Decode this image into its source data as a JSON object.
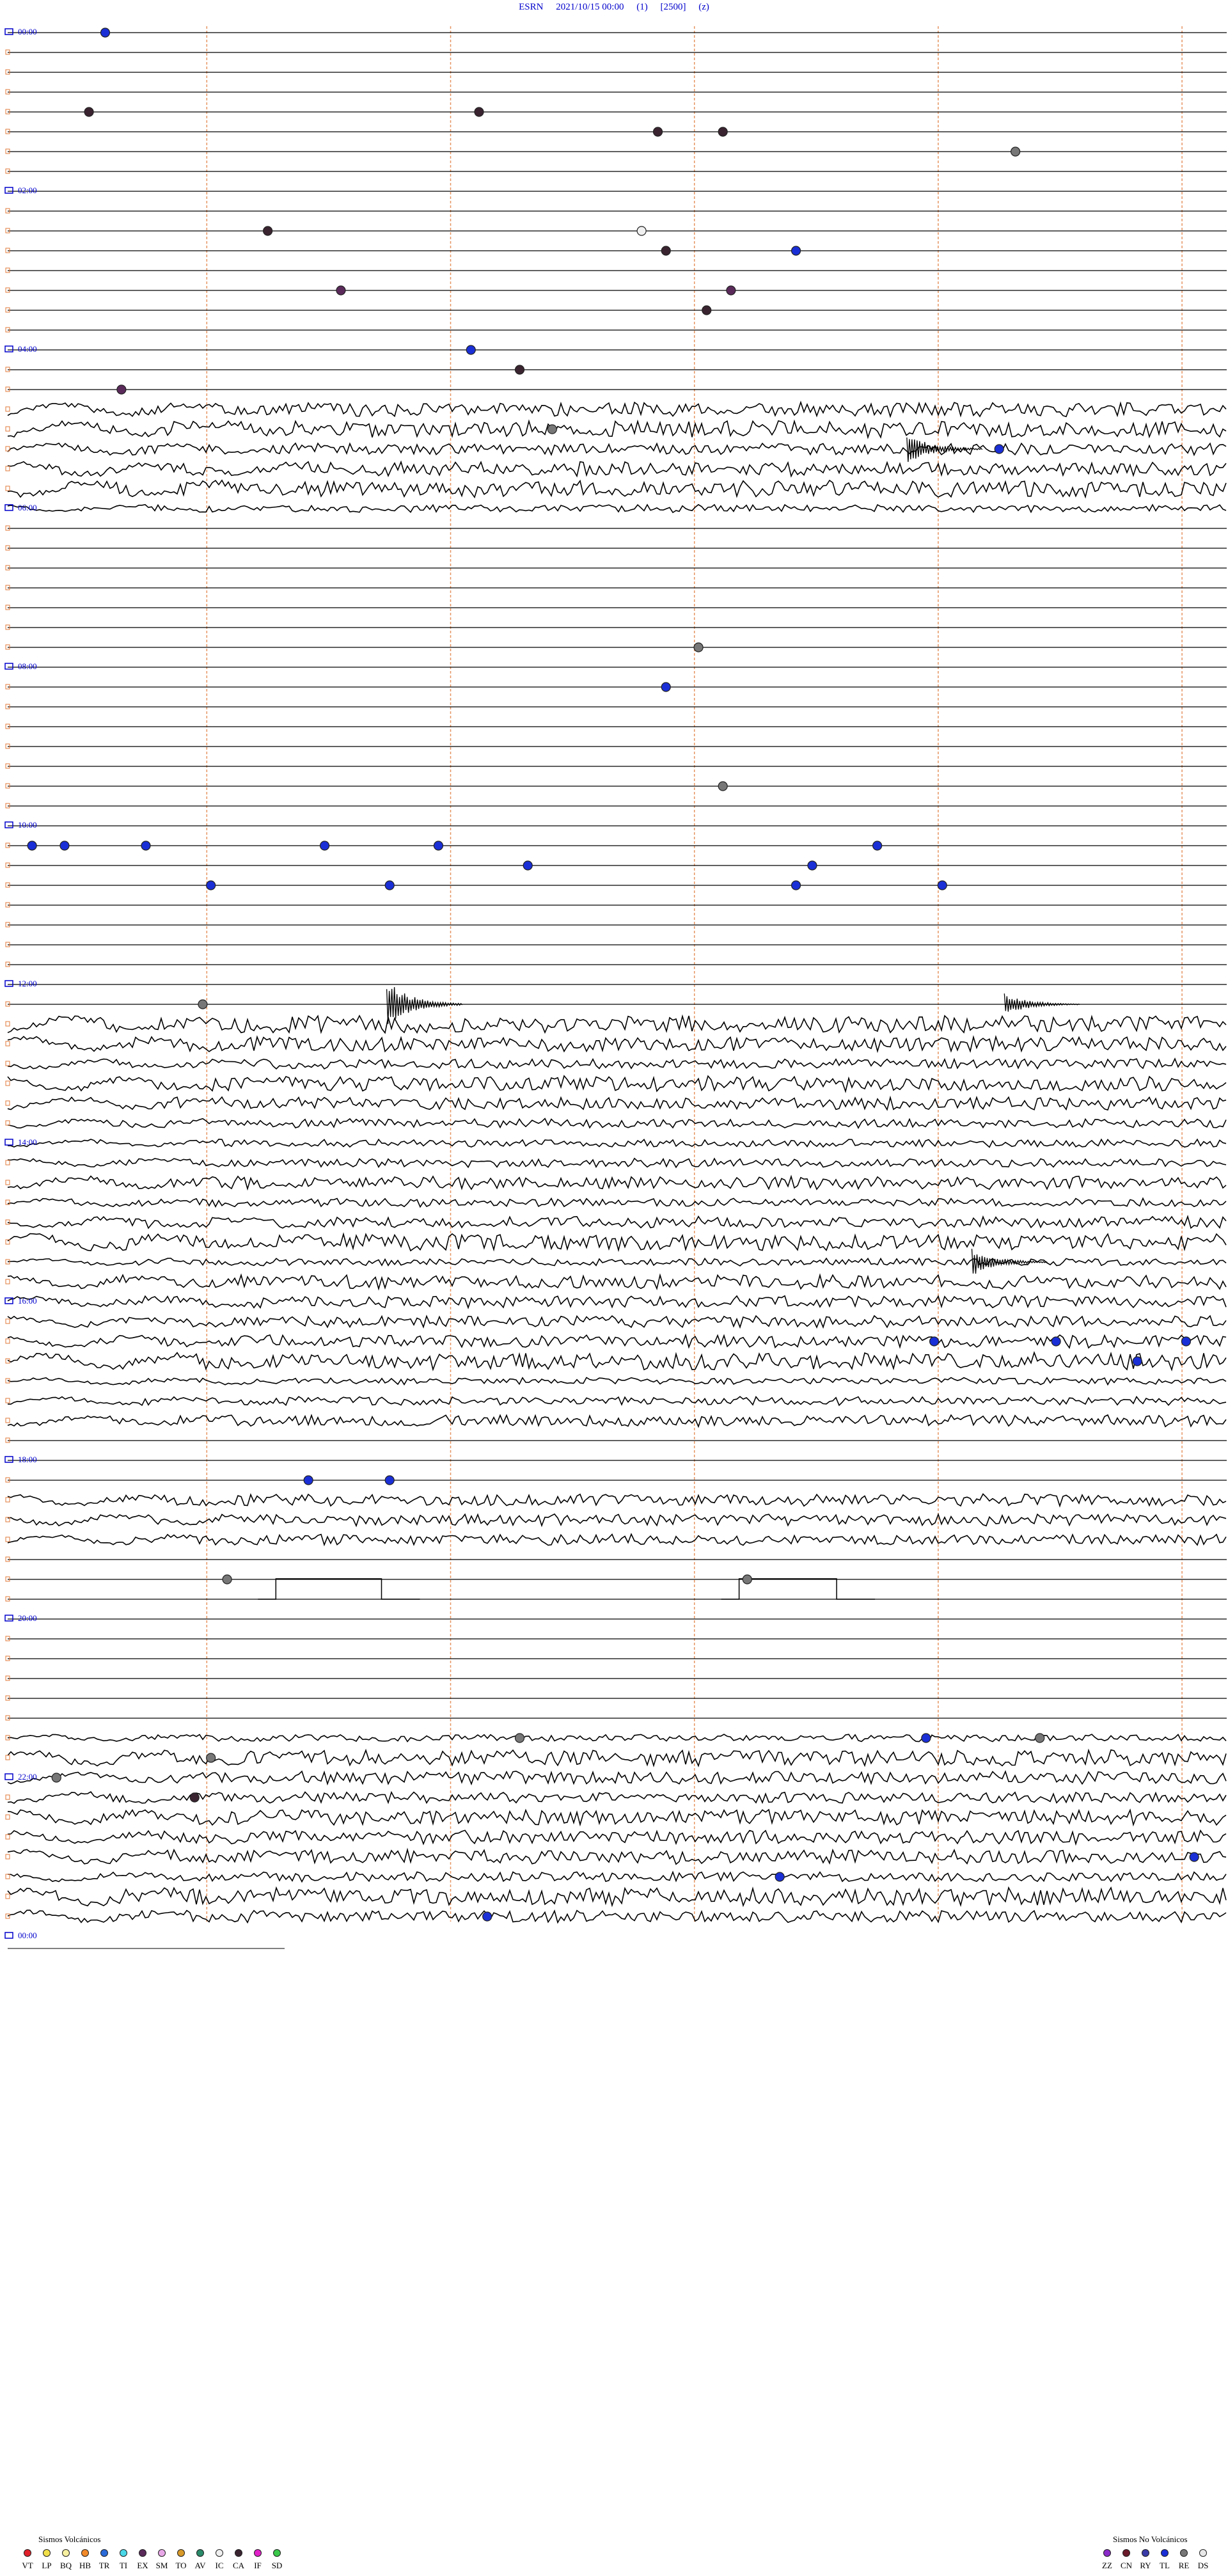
{
  "header": {
    "station": "ESRN",
    "datetime": "2021/10/15 00:00",
    "channel": "(1)",
    "scale": "[2500]",
    "mode": "(z)"
  },
  "chart_data": {
    "type": "helicorder",
    "rows": 96,
    "minutes_per_row": 15,
    "hour_labels": [
      "00:00",
      "02:00",
      "04:00",
      "06:00",
      "08:00",
      "10:00",
      "12:00",
      "14:00",
      "16:00",
      "18:00",
      "20:00",
      "22:00",
      "00:00"
    ],
    "minute_marker_count": 5,
    "colors": {
      "hour_label": "#0000cc",
      "trace": "#000000",
      "minute_marker": "#e07a3a",
      "event_blue": "#1a2fd6",
      "event_grey": "#777777",
      "event_dark": "#3a2430"
    },
    "noisy_row_ranges": [
      [
        19,
        24
      ],
      [
        50,
        70
      ],
      [
        74,
        76
      ],
      [
        86,
        95
      ]
    ],
    "spikes": [
      {
        "row": 21,
        "minute": 11.3,
        "amp": 1.0
      },
      {
        "row": 49,
        "minute": 4.9,
        "amp": 1.6
      },
      {
        "row": 49,
        "minute": 12.5,
        "amp": 0.7
      },
      {
        "row": 62,
        "minute": 12.1,
        "amp": 0.9
      }
    ],
    "step_pulses": [
      {
        "row": 79,
        "start_minute": 3.3,
        "end_minute": 4.6,
        "amp": 1.6
      },
      {
        "row": 79,
        "start_minute": 9.0,
        "end_minute": 10.2,
        "amp": 1.6
      }
    ],
    "events": [
      {
        "row": 0,
        "minute": 1.2,
        "type": "TL"
      },
      {
        "row": 4,
        "minute": 1.0,
        "type": "CA"
      },
      {
        "row": 4,
        "minute": 5.8,
        "type": "CA"
      },
      {
        "row": 5,
        "minute": 8.0,
        "type": "CA"
      },
      {
        "row": 5,
        "minute": 8.8,
        "type": "CA"
      },
      {
        "row": 6,
        "minute": 12.4,
        "type": "RE"
      },
      {
        "row": 10,
        "minute": 3.2,
        "type": "CA"
      },
      {
        "row": 10,
        "minute": 7.8,
        "type": "IC"
      },
      {
        "row": 11,
        "minute": 9.7,
        "type": "TL"
      },
      {
        "row": 11,
        "minute": 8.1,
        "type": "CA"
      },
      {
        "row": 13,
        "minute": 4.1,
        "type": "EX"
      },
      {
        "row": 13,
        "minute": 8.9,
        "type": "EX"
      },
      {
        "row": 14,
        "minute": 8.6,
        "type": "CA"
      },
      {
        "row": 16,
        "minute": 5.7,
        "type": "TL"
      },
      {
        "row": 17,
        "minute": 6.3,
        "type": "CA"
      },
      {
        "row": 18,
        "minute": 1.4,
        "type": "EX"
      },
      {
        "row": 20,
        "minute": 6.7,
        "type": "RE"
      },
      {
        "row": 21,
        "minute": 12.2,
        "type": "TL"
      },
      {
        "row": 31,
        "minute": 8.5,
        "type": "RE"
      },
      {
        "row": 33,
        "minute": 8.1,
        "type": "TL"
      },
      {
        "row": 38,
        "minute": 8.8,
        "type": "RE"
      },
      {
        "row": 41,
        "minute": 0.3,
        "type": "TL"
      },
      {
        "row": 41,
        "minute": 0.7,
        "type": "TL"
      },
      {
        "row": 41,
        "minute": 1.7,
        "type": "TL"
      },
      {
        "row": 41,
        "minute": 3.9,
        "type": "TL"
      },
      {
        "row": 41,
        "minute": 5.3,
        "type": "TL"
      },
      {
        "row": 41,
        "minute": 10.7,
        "type": "TL"
      },
      {
        "row": 42,
        "minute": 6.4,
        "type": "TL"
      },
      {
        "row": 42,
        "minute": 9.9,
        "type": "TL"
      },
      {
        "row": 43,
        "minute": 2.5,
        "type": "TL"
      },
      {
        "row": 43,
        "minute": 9.7,
        "type": "TL"
      },
      {
        "row": 43,
        "minute": 11.5,
        "type": "TL"
      },
      {
        "row": 43,
        "minute": 4.7,
        "type": "TL"
      },
      {
        "row": 49,
        "minute": 2.4,
        "type": "RE"
      },
      {
        "row": 66,
        "minute": 11.4,
        "type": "TL"
      },
      {
        "row": 66,
        "minute": 12.9,
        "type": "TL"
      },
      {
        "row": 66,
        "minute": 14.5,
        "type": "TL"
      },
      {
        "row": 67,
        "minute": 13.9,
        "type": "TL"
      },
      {
        "row": 73,
        "minute": 3.7,
        "type": "TL"
      },
      {
        "row": 73,
        "minute": 4.7,
        "type": "TL"
      },
      {
        "row": 78,
        "minute": 2.7,
        "type": "RE"
      },
      {
        "row": 78,
        "minute": 9.1,
        "type": "RE"
      },
      {
        "row": 86,
        "minute": 6.3,
        "type": "RE"
      },
      {
        "row": 86,
        "minute": 11.3,
        "type": "TL"
      },
      {
        "row": 86,
        "minute": 12.7,
        "type": "RE"
      },
      {
        "row": 87,
        "minute": 2.5,
        "type": "RE"
      },
      {
        "row": 88,
        "minute": 0.6,
        "type": "RE"
      },
      {
        "row": 89,
        "minute": 2.3,
        "type": "CA"
      },
      {
        "row": 92,
        "minute": 14.6,
        "type": "TL"
      },
      {
        "row": 93,
        "minute": 9.5,
        "type": "TL"
      },
      {
        "row": 95,
        "minute": 5.9,
        "type": "TL"
      }
    ]
  },
  "legend": {
    "volcanic_title": "Sismos Volcánicos",
    "volcanic": [
      {
        "code": "VT",
        "color": "#e0202a"
      },
      {
        "code": "LP",
        "color": "#f2e04a"
      },
      {
        "code": "BQ",
        "color": "#f6f0a0"
      },
      {
        "code": "HB",
        "color": "#f28a2a"
      },
      {
        "code": "TR",
        "color": "#2a6ad8"
      },
      {
        "code": "TI",
        "color": "#4ad8e8"
      },
      {
        "code": "EX",
        "color": "#5a2a5a"
      },
      {
        "code": "SM",
        "color": "#e8a8e8"
      },
      {
        "code": "TO",
        "color": "#d89a2a"
      },
      {
        "code": "AV",
        "color": "#2a8a6a"
      },
      {
        "code": "IC",
        "color": "#f0f0f0"
      },
      {
        "code": "CA",
        "color": "#3a2430"
      },
      {
        "code": "IF",
        "color": "#e020c8"
      },
      {
        "code": "SD",
        "color": "#3ac84a"
      }
    ],
    "nonvolcanic_title": "Sismos No Volcánicos",
    "nonvolcanic": [
      {
        "code": "ZZ",
        "color": "#8a2ac8"
      },
      {
        "code": "CN",
        "color": "#6a1a2a"
      },
      {
        "code": "RY",
        "color": "#3a3aa8"
      },
      {
        "code": "TL",
        "color": "#1a2fd6"
      },
      {
        "code": "RE",
        "color": "#777777"
      },
      {
        "code": "DS",
        "color": "#e8e8e8"
      }
    ]
  }
}
